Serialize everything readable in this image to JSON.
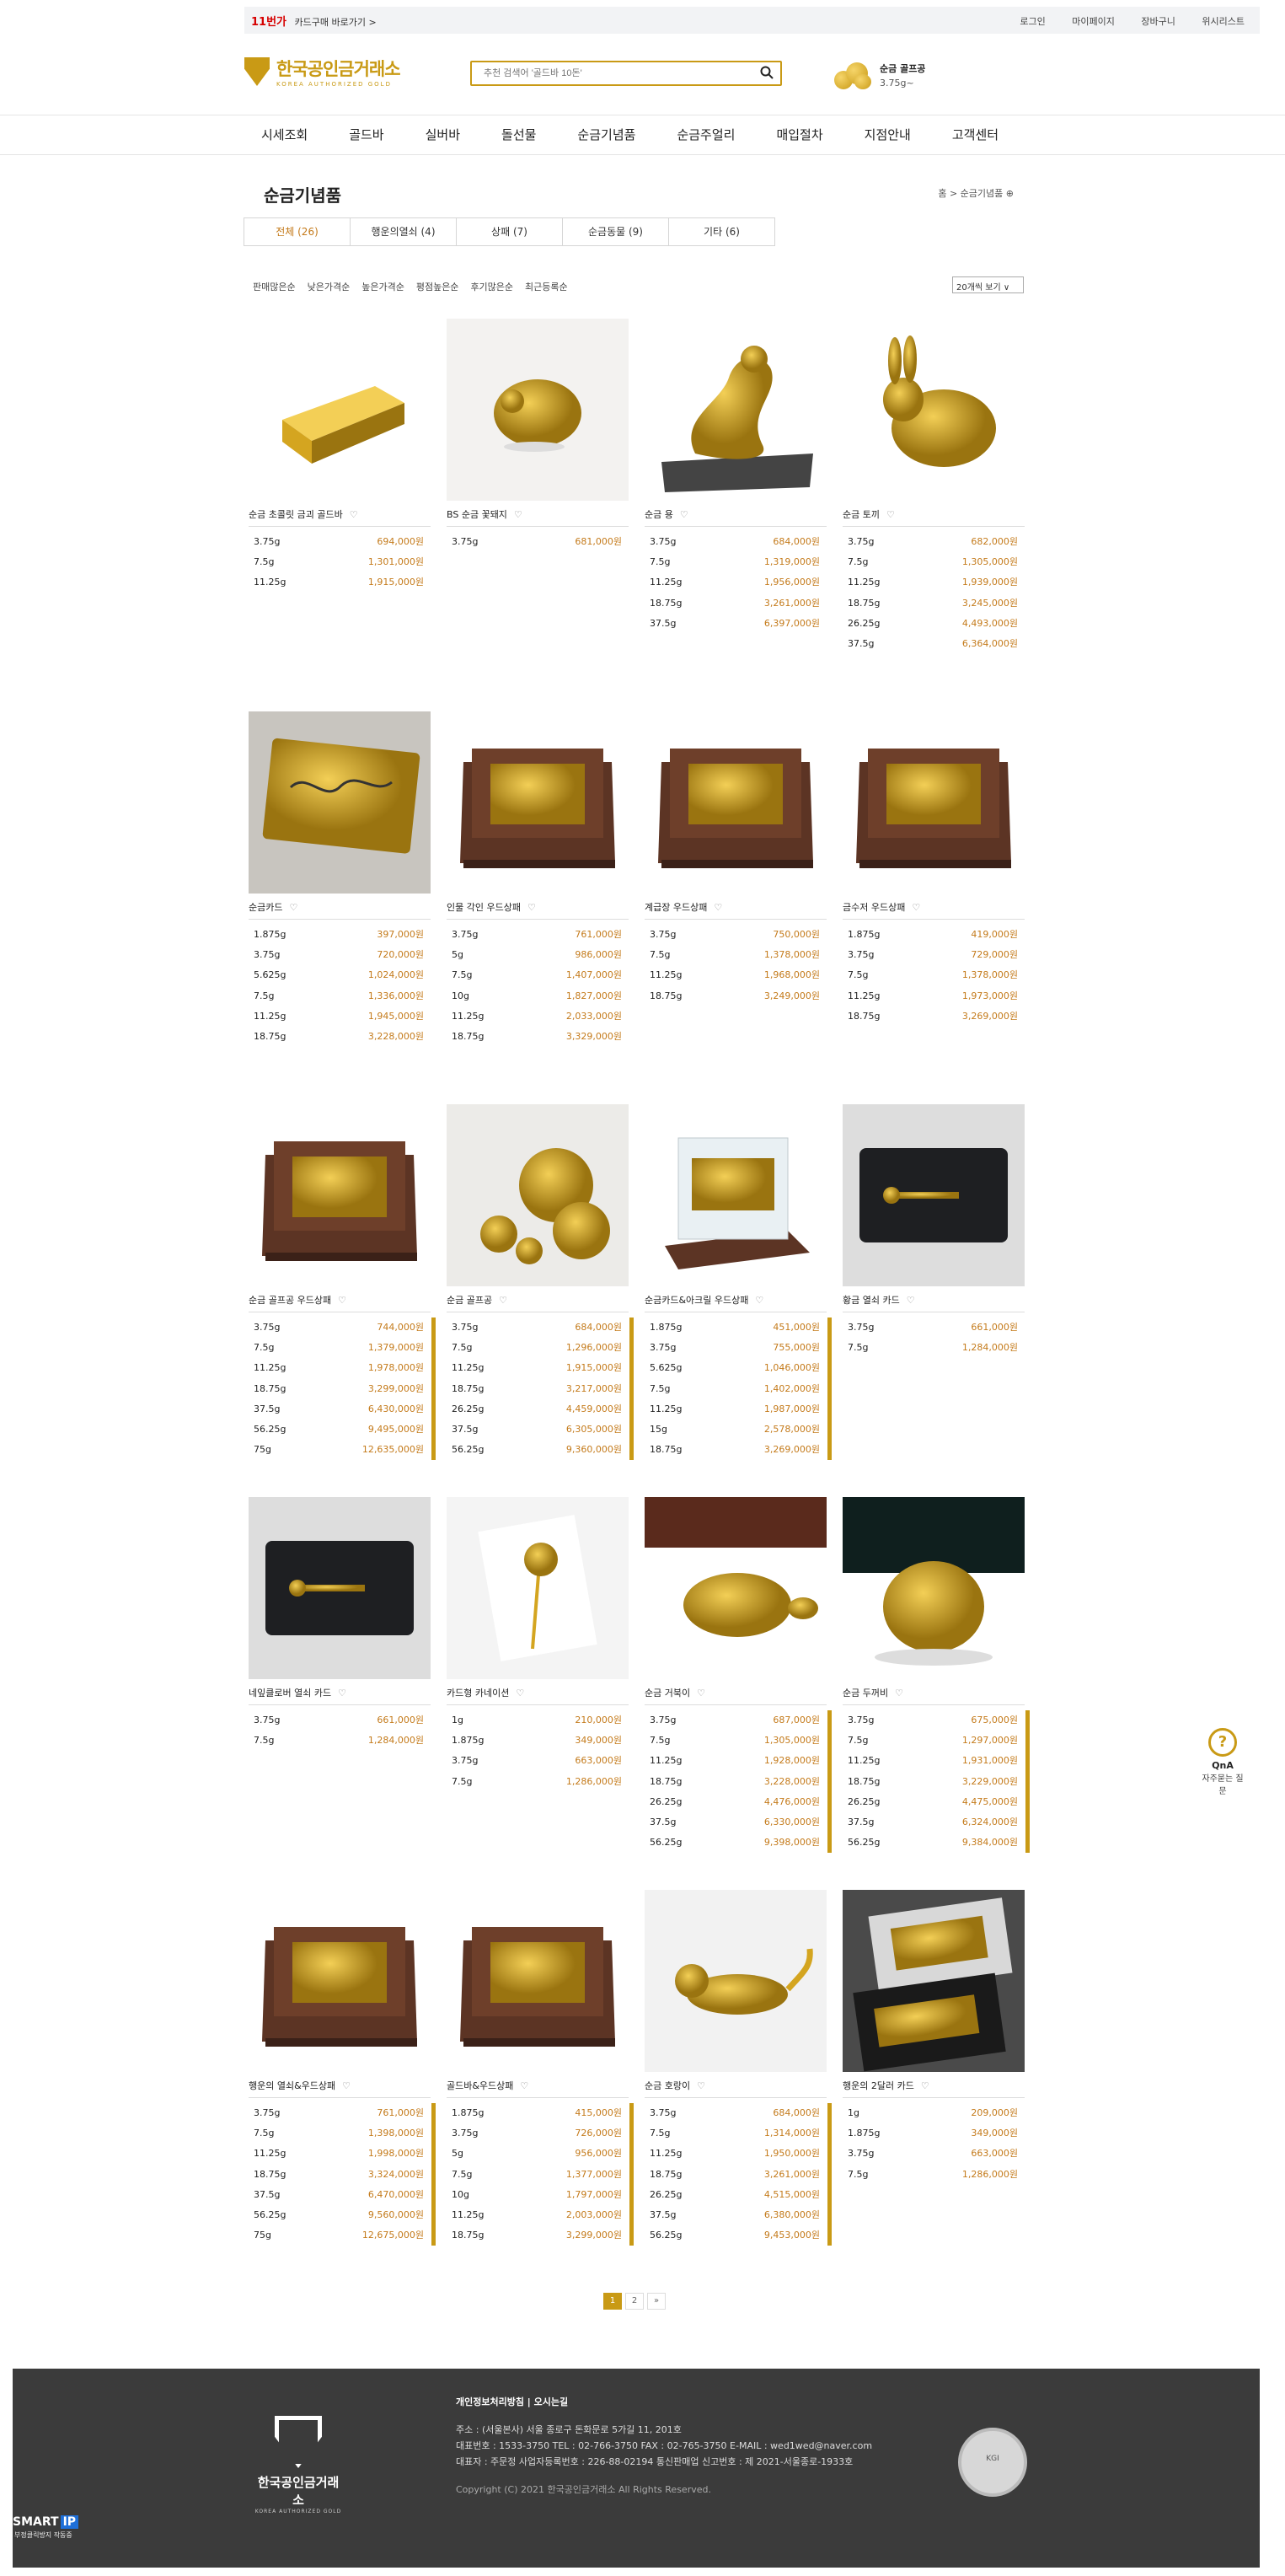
{
  "topbar": {
    "card_promo": "카드구매 바로가기 >",
    "card_badge": "11번가",
    "links": [
      "로그인",
      "마이페이지",
      "장바구니",
      "위시리스트"
    ]
  },
  "header": {
    "logo_kr": "한국공인금거래소",
    "logo_en": "KOREA AUTHORIZED GOLD",
    "search_placeholder": "추천 검색어 '골드바 10돈'",
    "price_title": "순금 골프공",
    "price_value": "3.75g~"
  },
  "nav": [
    "시세조회",
    "골드바",
    "실버바",
    "돌선물",
    "순금기념품",
    "순금주얼리",
    "매입절차",
    "지점안내",
    "고객센터"
  ],
  "page_title": "순금기념품",
  "breadcrumb": "홈 > 순금기념품 ⊕",
  "tabs": [
    "전체 (26)",
    "행운의열쇠 (4)",
    "상패 (7)",
    "순금동물 (9)",
    "기타 (6)"
  ],
  "sorts": [
    "판매많은순",
    "낮은가격순",
    "높은가격순",
    "평점높은순",
    "후기많은순",
    "최근등록순"
  ],
  "view_select": "20개씩 보기 ∨",
  "products": [
    {
      "name": "순금 초콜릿 금괴 골드바",
      "img": "goldbar",
      "prices": [
        [
          "3.75g",
          "694,000원"
        ],
        [
          "7.5g",
          "1,301,000원"
        ],
        [
          "11.25g",
          "1,915,000원"
        ]
      ]
    },
    {
      "name": "BS 순금 꽃돼지",
      "img": "pig",
      "prices": [
        [
          "3.75g",
          "681,000원"
        ]
      ]
    },
    {
      "name": "순금 용",
      "img": "dragon",
      "prices": [
        [
          "3.75g",
          "684,000원"
        ],
        [
          "7.5g",
          "1,319,000원"
        ],
        [
          "11.25g",
          "1,956,000원"
        ],
        [
          "18.75g",
          "3,261,000원"
        ],
        [
          "37.5g",
          "6,397,000원"
        ]
      ]
    },
    {
      "name": "순금 토끼",
      "img": "rabbit",
      "prices": [
        [
          "3.75g",
          "682,000원"
        ],
        [
          "7.5g",
          "1,305,000원"
        ],
        [
          "11.25g",
          "1,939,000원"
        ],
        [
          "18.75g",
          "3,245,000원"
        ],
        [
          "26.25g",
          "4,493,000원"
        ],
        [
          "37.5g",
          "6,364,000원"
        ]
      ]
    },
    {
      "name": "순금카드",
      "img": "card-gold",
      "prices": [
        [
          "1.875g",
          "397,000원"
        ],
        [
          "3.75g",
          "720,000원"
        ],
        [
          "5.625g",
          "1,024,000원"
        ],
        [
          "7.5g",
          "1,336,000원"
        ],
        [
          "11.25g",
          "1,945,000원"
        ],
        [
          "18.75g",
          "3,228,000원"
        ]
      ]
    },
    {
      "name": "인물 각인 우드상패",
      "img": "plaque",
      "prices": [
        [
          "3.75g",
          "761,000원"
        ],
        [
          "5g",
          "986,000원"
        ],
        [
          "7.5g",
          "1,407,000원"
        ],
        [
          "10g",
          "1,827,000원"
        ],
        [
          "11.25g",
          "2,033,000원"
        ],
        [
          "18.75g",
          "3,329,000원"
        ]
      ]
    },
    {
      "name": "계급장 우드상패",
      "img": "plaque",
      "prices": [
        [
          "3.75g",
          "750,000원"
        ],
        [
          "7.5g",
          "1,378,000원"
        ],
        [
          "11.25g",
          "1,968,000원"
        ],
        [
          "18.75g",
          "3,249,000원"
        ]
      ]
    },
    {
      "name": "금수저 우드상패",
      "img": "plaque",
      "prices": [
        [
          "1.875g",
          "419,000원"
        ],
        [
          "3.75g",
          "729,000원"
        ],
        [
          "7.5g",
          "1,378,000원"
        ],
        [
          "11.25g",
          "1,973,000원"
        ],
        [
          "18.75g",
          "3,269,000원"
        ]
      ]
    },
    {
      "name": "순금 골프공 우드상패",
      "img": "plaque",
      "prices": [
        [
          "3.75g",
          "744,000원"
        ],
        [
          "7.5g",
          "1,379,000원"
        ],
        [
          "11.25g",
          "1,978,000원"
        ],
        [
          "18.75g",
          "3,299,000원"
        ],
        [
          "37.5g",
          "6,430,000원"
        ],
        [
          "56.25g",
          "9,495,000원"
        ],
        [
          "75g",
          "12,635,000원"
        ]
      ]
    },
    {
      "name": "순금 골프공",
      "img": "golfballs",
      "prices": [
        [
          "3.75g",
          "684,000원"
        ],
        [
          "7.5g",
          "1,296,000원"
        ],
        [
          "11.25g",
          "1,915,000원"
        ],
        [
          "18.75g",
          "3,217,000원"
        ],
        [
          "26.25g",
          "4,459,000원"
        ],
        [
          "37.5g",
          "6,305,000원"
        ],
        [
          "56.25g",
          "9,360,000원"
        ]
      ]
    },
    {
      "name": "순금카드&아크릴 우드상패",
      "img": "acrylic",
      "prices": [
        [
          "1.875g",
          "451,000원"
        ],
        [
          "3.75g",
          "755,000원"
        ],
        [
          "5.625g",
          "1,046,000원"
        ],
        [
          "7.5g",
          "1,402,000원"
        ],
        [
          "11.25g",
          "1,987,000원"
        ],
        [
          "15g",
          "2,578,000원"
        ],
        [
          "18.75g",
          "3,269,000원"
        ]
      ]
    },
    {
      "name": "황금 열쇠 카드",
      "img": "blackcard",
      "prices": [
        [
          "3.75g",
          "661,000원"
        ],
        [
          "7.5g",
          "1,284,000원"
        ]
      ]
    },
    {
      "name": "네잎클로버 열쇠 카드",
      "img": "blackcard",
      "prices": [
        [
          "3.75g",
          "661,000원"
        ],
        [
          "7.5g",
          "1,284,000원"
        ]
      ]
    },
    {
      "name": "카드형 카네이션",
      "img": "carnation",
      "prices": [
        [
          "1g",
          "210,000원"
        ],
        [
          "1.875g",
          "349,000원"
        ],
        [
          "3.75g",
          "663,000원"
        ],
        [
          "7.5g",
          "1,286,000원"
        ]
      ]
    },
    {
      "name": "순금 거북이",
      "img": "turtle",
      "prices": [
        [
          "3.75g",
          "687,000원"
        ],
        [
          "7.5g",
          "1,305,000원"
        ],
        [
          "11.25g",
          "1,928,000원"
        ],
        [
          "18.75g",
          "3,228,000원"
        ],
        [
          "26.25g",
          "4,476,000원"
        ],
        [
          "37.5g",
          "6,330,000원"
        ],
        [
          "56.25g",
          "9,398,000원"
        ]
      ]
    },
    {
      "name": "순금 두꺼비",
      "img": "toad",
      "prices": [
        [
          "3.75g",
          "675,000원"
        ],
        [
          "7.5g",
          "1,297,000원"
        ],
        [
          "11.25g",
          "1,931,000원"
        ],
        [
          "18.75g",
          "3,229,000원"
        ],
        [
          "26.25g",
          "4,475,000원"
        ],
        [
          "37.5g",
          "6,324,000원"
        ],
        [
          "56.25g",
          "9,384,000원"
        ]
      ]
    },
    {
      "name": "행운의 열쇠&우드상패",
      "img": "plaque",
      "prices": [
        [
          "3.75g",
          "761,000원"
        ],
        [
          "7.5g",
          "1,398,000원"
        ],
        [
          "11.25g",
          "1,998,000원"
        ],
        [
          "18.75g",
          "3,324,000원"
        ],
        [
          "37.5g",
          "6,470,000원"
        ],
        [
          "56.25g",
          "9,560,000원"
        ],
        [
          "75g",
          "12,675,000원"
        ]
      ]
    },
    {
      "name": "골드바&우드상패",
      "img": "plaque",
      "prices": [
        [
          "1.875g",
          "415,000원"
        ],
        [
          "3.75g",
          "726,000원"
        ],
        [
          "5g",
          "956,000원"
        ],
        [
          "7.5g",
          "1,377,000원"
        ],
        [
          "10g",
          "1,797,000원"
        ],
        [
          "11.25g",
          "2,003,000원"
        ],
        [
          "18.75g",
          "3,299,000원"
        ]
      ]
    },
    {
      "name": "순금 호랑이",
      "img": "tiger",
      "prices": [
        [
          "3.75g",
          "684,000원"
        ],
        [
          "7.5g",
          "1,314,000원"
        ],
        [
          "11.25g",
          "1,950,000원"
        ],
        [
          "18.75g",
          "3,261,000원"
        ],
        [
          "26.25g",
          "4,515,000원"
        ],
        [
          "37.5g",
          "6,380,000원"
        ],
        [
          "56.25g",
          "9,453,000원"
        ]
      ]
    },
    {
      "name": "행운의 2달러 카드",
      "img": "dollar",
      "prices": [
        [
          "1g",
          "209,000원"
        ],
        [
          "1.875g",
          "349,000원"
        ],
        [
          "3.75g",
          "663,000원"
        ],
        [
          "7.5g",
          "1,286,000원"
        ]
      ]
    }
  ],
  "pager": [
    "1",
    "2",
    "»"
  ],
  "qna": {
    "title": "QnA",
    "sub": "자주묻는 질문"
  },
  "footer": {
    "logo_kr": "한국공인금거래소",
    "logo_en": "KOREA AUTHORIZED GOLD",
    "privacy": "개인정보처리방침 | 오시는길",
    "address": "주소 : (서울본사) 서울 종로구 돈화문로 5가길 11, 201호",
    "contact": "대표번호 : 1533-3750    TEL : 02-766-3750    FAX : 02-765-3750    E-MAIL : wed1wed@naver.com",
    "biz": "대표자 : 주문정    사업자등록번호 : 226-88-02194    통신판매업 신고번호 : 제 2021-서울종로-1933호",
    "copyright": "Copyright (C) 2021 한국공인금거래소 All Rights Reserved.",
    "seal": "KGI"
  },
  "smartip": {
    "brand": "SMART",
    "badge": "IP",
    "sub": "부정클릭방지 작동중"
  }
}
